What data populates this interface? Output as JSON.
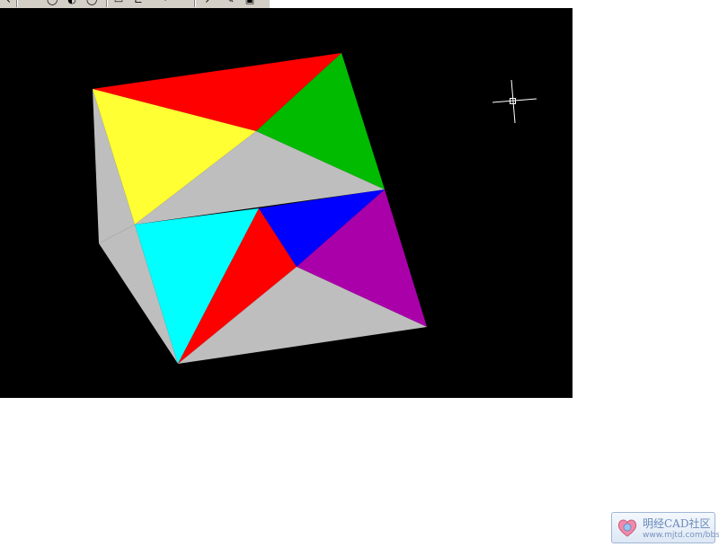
{
  "toolbar": {
    "icons": [
      "arrow-icon",
      "orbit-icon",
      "rotate-icon",
      "refresh-icon",
      "grid-icon",
      "snap-icon",
      "view-icon",
      "pick-icon",
      "edit-icon",
      "window-icon"
    ]
  },
  "viewport": {
    "background": "#000000",
    "cursor": "crosshair-icon",
    "model": {
      "name": "colored-prism",
      "face_colors": {
        "red": "#ff0000",
        "green": "#00bb00",
        "yellow": "#ffff33",
        "gray": "#bebebe",
        "cyan": "#00ffff",
        "blue": "#0000ff",
        "magenta": "#aa00aa"
      }
    }
  },
  "watermark": {
    "title": "明经CAD社区",
    "url": "www.mjtd.com/bbs"
  }
}
